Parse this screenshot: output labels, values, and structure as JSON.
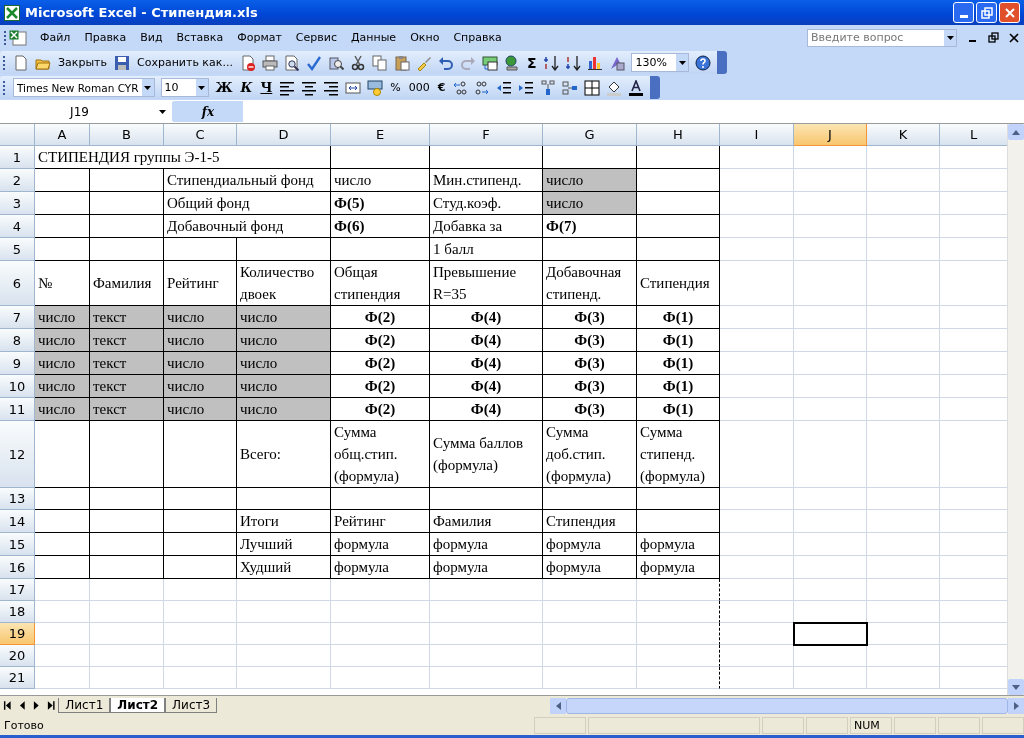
{
  "window": {
    "title": "Microsoft Excel - Стипендия.xls"
  },
  "menu": [
    "Файл",
    "Правка",
    "Вид",
    "Вставка",
    "Формат",
    "Сервис",
    "Данные",
    "Окно",
    "Справка"
  ],
  "help_box": {
    "placeholder": "Введите вопрос"
  },
  "standard_toolbar": {
    "close_label": "Закрыть",
    "save_as_label": "Сохранить как...",
    "sum": "Σ",
    "zoom": "130%"
  },
  "formatting_toolbar": {
    "font": "Times New Roman CYR",
    "size": "10",
    "bold": "Ж",
    "italic": "К",
    "underline": "Ч",
    "percent": "%",
    "thousands": "000",
    "euro": "€"
  },
  "formula_bar": {
    "name_box": "J19",
    "fx": "fx"
  },
  "columns": [
    {
      "label": "A",
      "selected": false
    },
    {
      "label": "B",
      "selected": false
    },
    {
      "label": "C",
      "selected": false
    },
    {
      "label": "D",
      "selected": false
    },
    {
      "label": "E",
      "selected": false
    },
    {
      "label": "F",
      "selected": false
    },
    {
      "label": "G",
      "selected": false
    },
    {
      "label": "H",
      "selected": false
    },
    {
      "label": "I",
      "selected": false
    },
    {
      "label": "J",
      "selected": true
    },
    {
      "label": "K",
      "selected": false
    },
    {
      "label": "L",
      "selected": false
    }
  ],
  "rows": [
    {
      "label": "1",
      "selected": false,
      "cells": [
        {
          "kind": "plain",
          "text": "СТИПЕНДИЯ группы Э-1-5"
        },
        {
          "kind": "covered"
        },
        {
          "kind": "covered"
        },
        {
          "kind": "covered"
        }
      ]
    },
    {
      "label": "2",
      "selected": false,
      "cells": [
        {
          "kind": "empty"
        },
        {
          "kind": "empty"
        },
        {
          "kind": "plain",
          "text": "Стипендиальный фонд"
        },
        {
          "kind": "covered"
        },
        {
          "kind": "plain",
          "text": "число"
        },
        {
          "kind": "plain",
          "text": "Мин.стипенд."
        },
        {
          "kind": "shaded",
          "text": "число"
        }
      ]
    },
    {
      "label": "3",
      "selected": false,
      "cells": [
        {
          "kind": "empty"
        },
        {
          "kind": "empty"
        },
        {
          "kind": "plain",
          "text": "Общий фонд"
        },
        {
          "kind": "covered"
        },
        {
          "kind": "bold",
          "text": "Ф(5)"
        },
        {
          "kind": "plain",
          "text": "Студ.коэф."
        },
        {
          "kind": "shaded",
          "text": "число"
        }
      ]
    },
    {
      "label": "4",
      "selected": false,
      "cells": [
        {
          "kind": "empty"
        },
        {
          "kind": "empty"
        },
        {
          "kind": "plain",
          "text": "Добавочный фонд"
        },
        {
          "kind": "covered"
        },
        {
          "kind": "bold",
          "text": "Ф(6)"
        },
        {
          "kind": "plain",
          "text": "Добавка за"
        },
        {
          "kind": "bold",
          "text": "Ф(7)"
        }
      ]
    },
    {
      "label": "5",
      "selected": false,
      "cells": [
        {
          "kind": "empty"
        },
        {
          "kind": "empty"
        },
        {
          "kind": "empty"
        },
        {
          "kind": "empty"
        },
        {
          "kind": "empty"
        },
        {
          "kind": "plain",
          "text": "1 балл"
        }
      ]
    },
    {
      "label": "6",
      "selected": false,
      "cells": [
        {
          "kind": "plain",
          "text": "№"
        },
        {
          "kind": "plain",
          "text": "Фамилия"
        },
        {
          "kind": "plain",
          "text": "Рейтинг"
        },
        {
          "kind": "plain",
          "text": "Количество\nдвоек"
        },
        {
          "kind": "plain",
          "text": "Общая\nстипендия"
        },
        {
          "kind": "plain",
          "text": "Превышение\nR=35"
        },
        {
          "kind": "plain",
          "text": "Добавочная\nстипенд."
        },
        {
          "kind": "plain",
          "text": "Стипендия"
        }
      ]
    },
    {
      "label": "7",
      "selected": false,
      "cells": [
        {
          "kind": "shaded",
          "text": "число"
        },
        {
          "kind": "shaded",
          "text": "текст"
        },
        {
          "kind": "shaded",
          "text": "число"
        },
        {
          "kind": "shaded",
          "text": "число"
        },
        {
          "kind": "formula",
          "text": "Ф(2)"
        },
        {
          "kind": "formula",
          "text": "Ф(4)"
        },
        {
          "kind": "formula",
          "text": "Ф(3)"
        },
        {
          "kind": "formula",
          "text": "Ф(1)"
        }
      ]
    },
    {
      "label": "8",
      "selected": false,
      "cells": [
        {
          "kind": "shaded",
          "text": "число"
        },
        {
          "kind": "shaded",
          "text": "текст"
        },
        {
          "kind": "shaded",
          "text": "число"
        },
        {
          "kind": "shaded",
          "text": "число"
        },
        {
          "kind": "formula",
          "text": "Ф(2)"
        },
        {
          "kind": "formula",
          "text": "Ф(4)"
        },
        {
          "kind": "formula",
          "text": "Ф(3)"
        },
        {
          "kind": "formula",
          "text": "Ф(1)"
        }
      ]
    },
    {
      "label": "9",
      "selected": false,
      "cells": [
        {
          "kind": "shaded",
          "text": "число"
        },
        {
          "kind": "shaded",
          "text": "текст"
        },
        {
          "kind": "shaded",
          "text": "число"
        },
        {
          "kind": "shaded",
          "text": "число"
        },
        {
          "kind": "formula",
          "text": "Ф(2)"
        },
        {
          "kind": "formula",
          "text": "Ф(4)"
        },
        {
          "kind": "formula",
          "text": "Ф(3)"
        },
        {
          "kind": "formula",
          "text": "Ф(1)"
        }
      ]
    },
    {
      "label": "10",
      "selected": false,
      "cells": [
        {
          "kind": "shaded",
          "text": "число"
        },
        {
          "kind": "shaded",
          "text": "текст"
        },
        {
          "kind": "shaded",
          "text": "число"
        },
        {
          "kind": "shaded",
          "text": "число"
        },
        {
          "kind": "formula",
          "text": "Ф(2)"
        },
        {
          "kind": "formula",
          "text": "Ф(4)"
        },
        {
          "kind": "formula",
          "text": "Ф(3)"
        },
        {
          "kind": "formula",
          "text": "Ф(1)"
        }
      ]
    },
    {
      "label": "11",
      "selected": false,
      "cells": [
        {
          "kind": "shaded",
          "text": "число"
        },
        {
          "kind": "shaded",
          "text": "текст"
        },
        {
          "kind": "shaded",
          "text": "число"
        },
        {
          "kind": "shaded",
          "text": "число"
        },
        {
          "kind": "formula",
          "text": "Ф(2)"
        },
        {
          "kind": "formula",
          "text": "Ф(4)"
        },
        {
          "kind": "formula",
          "text": "Ф(3)"
        },
        {
          "kind": "formula",
          "text": "Ф(1)"
        }
      ]
    },
    {
      "label": "12",
      "selected": false,
      "cells": [
        {
          "kind": "empty"
        },
        {
          "kind": "empty"
        },
        {
          "kind": "empty"
        },
        {
          "kind": "plain",
          "text": "Всего:"
        },
        {
          "kind": "plain",
          "text": "Сумма\nобщ.стип.\n(формула)"
        },
        {
          "kind": "plain",
          "text": "Сумма баллов\n(формула)"
        },
        {
          "kind": "plain",
          "text": "Сумма\nдоб.стип.\n(формула)"
        },
        {
          "kind": "plain",
          "text": "Сумма\nстипенд.\n(формула)"
        }
      ]
    },
    {
      "label": "13",
      "selected": false,
      "cells": []
    },
    {
      "label": "14",
      "selected": false,
      "cells": [
        {
          "kind": "empty"
        },
        {
          "kind": "empty"
        },
        {
          "kind": "empty"
        },
        {
          "kind": "plain",
          "text": "Итоги"
        },
        {
          "kind": "plain",
          "text": "Рейтинг"
        },
        {
          "kind": "plain",
          "text": "Фамилия"
        },
        {
          "kind": "plain",
          "text": "Стипендия"
        }
      ]
    },
    {
      "label": "15",
      "selected": false,
      "cells": [
        {
          "kind": "empty"
        },
        {
          "kind": "empty"
        },
        {
          "kind": "empty"
        },
        {
          "kind": "plain",
          "text": "Лучший"
        },
        {
          "kind": "plain",
          "text": "формула"
        },
        {
          "kind": "plain",
          "text": "формула"
        },
        {
          "kind": "plain",
          "text": "формула"
        },
        {
          "kind": "plain",
          "text": "формула"
        }
      ]
    },
    {
      "label": "16",
      "selected": false,
      "cells": [
        {
          "kind": "empty"
        },
        {
          "kind": "empty"
        },
        {
          "kind": "empty"
        },
        {
          "kind": "plain",
          "text": "Худший"
        },
        {
          "kind": "plain",
          "text": "формула"
        },
        {
          "kind": "plain",
          "text": "формула"
        },
        {
          "kind": "plain",
          "text": "формула"
        },
        {
          "kind": "plain",
          "text": "формула"
        }
      ]
    },
    {
      "label": "17",
      "selected": false,
      "cells": []
    },
    {
      "label": "18",
      "selected": false,
      "cells": []
    },
    {
      "label": "19",
      "selected": true,
      "cells": []
    },
    {
      "label": "20",
      "selected": false,
      "cells": []
    },
    {
      "label": "21",
      "selected": false,
      "cells": []
    }
  ],
  "sheet_tabs": [
    {
      "label": "Лист1",
      "selected": false
    },
    {
      "label": "Лист2",
      "selected": true
    },
    {
      "label": "Лист3",
      "selected": false
    }
  ],
  "status_bar": {
    "status": "Готово",
    "indicator": "NUM"
  }
}
